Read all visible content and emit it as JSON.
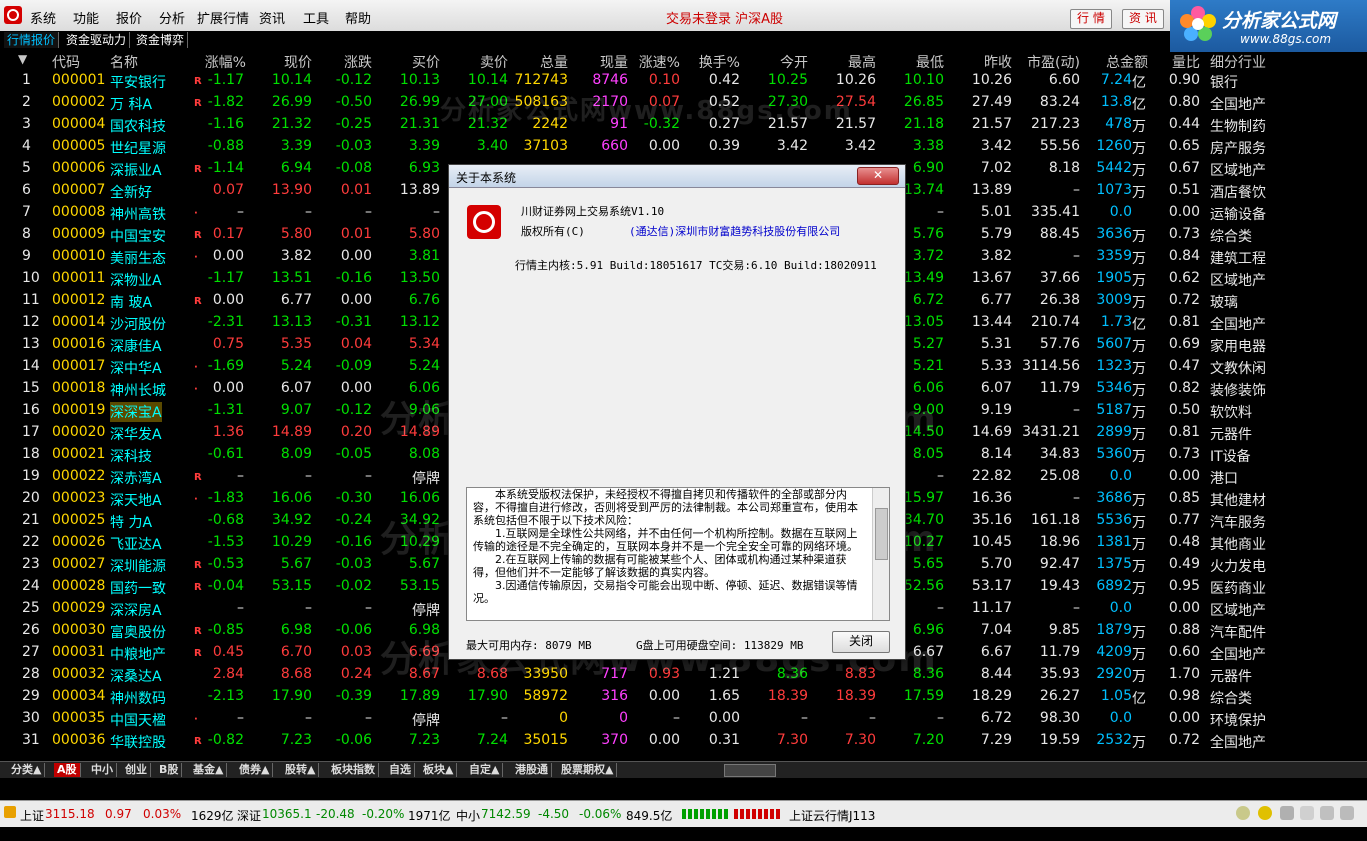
{
  "menubar": {
    "items": [
      "系统",
      "功能",
      "报价",
      "分析",
      "扩展行情",
      "资讯",
      "工具",
      "帮助"
    ],
    "status": "交易未登录  沪深A股",
    "buttons": [
      "行 情",
      "资 讯"
    ]
  },
  "brand": {
    "title": "分析家公式网",
    "url": "www.88gs.com"
  },
  "top_tabs": [
    "行情报价",
    "资金驱动力",
    "资金博弈"
  ],
  "table": {
    "headers": [
      "代码",
      "名称",
      "涨幅%",
      "现价",
      "涨跌",
      "买价",
      "卖价",
      "总量",
      "现量",
      "涨速%",
      "换手%",
      "今开",
      "最高",
      "最低",
      "昨收",
      "市盈(动)",
      "总金额",
      "量比",
      "细分行业"
    ],
    "rows": [
      {
        "i": "1",
        "code": "000001",
        "name": "平安银行",
        "b": "R",
        "chg": "-1.17",
        "price": "10.14",
        "diff": "-0.12",
        "buy": "10.13",
        "sell": "10.14",
        "vol": "712743",
        "cur": "8746",
        "spd": "0.10",
        "turn": "0.42",
        "open": "10.25",
        "high": "10.26",
        "low": "10.10",
        "prev": "10.26",
        "pe": "6.60",
        "amt": "7.24",
        "amtu": "亿",
        "lb": "0.90",
        "ind": "银行"
      },
      {
        "i": "2",
        "code": "000002",
        "name": "万 科A",
        "b": "R",
        "chg": "-1.82",
        "price": "26.99",
        "diff": "-0.50",
        "buy": "26.99",
        "sell": "27.00",
        "vol": "508163",
        "cur": "2170",
        "spd": "0.07",
        "turn": "0.52",
        "open": "27.30",
        "high": "27.54",
        "low": "26.85",
        "prev": "27.49",
        "pe": "83.24",
        "amt": "13.8",
        "amtu": "亿",
        "lb": "0.80",
        "ind": "全国地产"
      },
      {
        "i": "3",
        "code": "000004",
        "name": "国农科技",
        "b": "",
        "chg": "-1.16",
        "price": "21.32",
        "diff": "-0.25",
        "buy": "21.31",
        "sell": "21.32",
        "vol": "2242",
        "cur": "91",
        "spd": "-0.32",
        "turn": "0.27",
        "open": "21.57",
        "high": "21.57",
        "low": "21.18",
        "prev": "21.57",
        "pe": "217.23",
        "amt": "478",
        "amtu": "万",
        "lb": "0.44",
        "ind": "生物制药"
      },
      {
        "i": "4",
        "code": "000005",
        "name": "世纪星源",
        "b": "",
        "chg": "-0.88",
        "price": "3.39",
        "diff": "-0.03",
        "buy": "3.39",
        "sell": "3.40",
        "vol": "37103",
        "cur": "660",
        "spd": "0.00",
        "turn": "0.39",
        "open": "3.42",
        "high": "3.42",
        "low": "3.38",
        "prev": "3.42",
        "pe": "55.56",
        "amt": "1260",
        "amtu": "万",
        "lb": "0.65",
        "ind": "房产服务"
      },
      {
        "i": "5",
        "code": "000006",
        "name": "深振业A",
        "b": "R",
        "chg": "-1.14",
        "price": "6.94",
        "diff": "-0.08",
        "buy": "6.93",
        "sell": "",
        "vol": "",
        "cur": "",
        "spd": "",
        "turn": "",
        "open": "",
        "high": "",
        "low": "6.90",
        "prev": "7.02",
        "pe": "8.18",
        "amt": "5442",
        "amtu": "万",
        "lb": "0.67",
        "ind": "区域地产"
      },
      {
        "i": "6",
        "code": "000007",
        "name": "全新好",
        "b": "",
        "chg": "0.07",
        "price": "13.90",
        "diff": "0.01",
        "buy": "13.89",
        "sell": "",
        "vol": "",
        "cur": "",
        "spd": "",
        "turn": "",
        "open": "",
        "high": "",
        "low": "13.74",
        "prev": "13.89",
        "pe": "–",
        "amt": "1073",
        "amtu": "万",
        "lb": "0.51",
        "ind": "酒店餐饮"
      },
      {
        "i": "7",
        "code": "000008",
        "name": "神州高铁",
        "b": "·",
        "chg": "–",
        "price": "–",
        "diff": "–",
        "buy": "–",
        "sell": "",
        "vol": "",
        "cur": "",
        "spd": "",
        "turn": "",
        "open": "",
        "high": "",
        "low": "–",
        "prev": "5.01",
        "pe": "335.41",
        "amt": "0.0",
        "amtu": "",
        "lb": "0.00",
        "ind": "运输设备"
      },
      {
        "i": "8",
        "code": "000009",
        "name": "中国宝安",
        "b": "R",
        "chg": "0.17",
        "price": "5.80",
        "diff": "0.01",
        "buy": "5.80",
        "sell": "",
        "vol": "",
        "cur": "",
        "spd": "",
        "turn": "",
        "open": "",
        "high": "",
        "low": "5.76",
        "prev": "5.79",
        "pe": "88.45",
        "amt": "3636",
        "amtu": "万",
        "lb": "0.73",
        "ind": "综合类"
      },
      {
        "i": "9",
        "code": "000010",
        "name": "美丽生态",
        "b": "·",
        "chg": "0.00",
        "price": "3.82",
        "diff": "0.00",
        "buy": "3.81",
        "sell": "",
        "vol": "",
        "cur": "",
        "spd": "",
        "turn": "",
        "open": "",
        "high": "",
        "low": "3.72",
        "prev": "3.82",
        "pe": "–",
        "amt": "3359",
        "amtu": "万",
        "lb": "0.84",
        "ind": "建筑工程"
      },
      {
        "i": "10",
        "code": "000011",
        "name": "深物业A",
        "b": "",
        "chg": "-1.17",
        "price": "13.51",
        "diff": "-0.16",
        "buy": "13.50",
        "sell": "",
        "vol": "",
        "cur": "",
        "spd": "",
        "turn": "",
        "open": "",
        "high": "",
        "low": "13.49",
        "prev": "13.67",
        "pe": "37.66",
        "amt": "1905",
        "amtu": "万",
        "lb": "0.62",
        "ind": "区域地产"
      },
      {
        "i": "11",
        "code": "000012",
        "name": "南 玻A",
        "b": "R",
        "chg": "0.00",
        "price": "6.77",
        "diff": "0.00",
        "buy": "6.76",
        "sell": "",
        "vol": "",
        "cur": "",
        "spd": "",
        "turn": "",
        "open": "",
        "high": "",
        "low": "6.72",
        "prev": "6.77",
        "pe": "26.38",
        "amt": "3009",
        "amtu": "万",
        "lb": "0.72",
        "ind": "玻璃"
      },
      {
        "i": "12",
        "code": "000014",
        "name": "沙河股份",
        "b": "",
        "chg": "-2.31",
        "price": "13.13",
        "diff": "-0.31",
        "buy": "13.12",
        "sell": "",
        "vol": "",
        "cur": "",
        "spd": "",
        "turn": "",
        "open": "",
        "high": "",
        "low": "13.05",
        "prev": "13.44",
        "pe": "210.74",
        "amt": "1.73",
        "amtu": "亿",
        "lb": "0.81",
        "ind": "全国地产"
      },
      {
        "i": "13",
        "code": "000016",
        "name": "深康佳A",
        "b": "",
        "chg": "0.75",
        "price": "5.35",
        "diff": "0.04",
        "buy": "5.34",
        "sell": "",
        "vol": "",
        "cur": "",
        "spd": "",
        "turn": "",
        "open": "",
        "high": "",
        "low": "5.27",
        "prev": "5.31",
        "pe": "57.76",
        "amt": "5607",
        "amtu": "万",
        "lb": "0.69",
        "ind": "家用电器"
      },
      {
        "i": "14",
        "code": "000017",
        "name": "深中华A",
        "b": "·",
        "chg": "-1.69",
        "price": "5.24",
        "diff": "-0.09",
        "buy": "5.24",
        "sell": "",
        "vol": "",
        "cur": "",
        "spd": "",
        "turn": "",
        "open": "",
        "high": "",
        "low": "5.21",
        "prev": "5.33",
        "pe": "3114.56",
        "amt": "1323",
        "amtu": "万",
        "lb": "0.47",
        "ind": "文教休闲"
      },
      {
        "i": "15",
        "code": "000018",
        "name": "神州长城",
        "b": "·",
        "chg": "0.00",
        "price": "6.07",
        "diff": "0.00",
        "buy": "6.06",
        "sell": "",
        "vol": "",
        "cur": "",
        "spd": "",
        "turn": "",
        "open": "",
        "high": "",
        "low": "6.06",
        "prev": "6.07",
        "pe": "11.79",
        "amt": "5346",
        "amtu": "万",
        "lb": "0.82",
        "ind": "装修装饰"
      },
      {
        "i": "16",
        "code": "000019",
        "name": "深深宝A",
        "b": "",
        "chg": "-1.31",
        "price": "9.07",
        "diff": "-0.12",
        "buy": "9.06",
        "sell": "",
        "vol": "",
        "cur": "",
        "spd": "",
        "turn": "",
        "open": "",
        "high": "",
        "low": "9.00",
        "prev": "9.19",
        "pe": "–",
        "amt": "5187",
        "amtu": "万",
        "lb": "0.50",
        "ind": "软饮料"
      },
      {
        "i": "17",
        "code": "000020",
        "name": "深华发A",
        "b": "",
        "chg": "1.36",
        "price": "14.89",
        "diff": "0.20",
        "buy": "14.89",
        "sell": "",
        "vol": "",
        "cur": "",
        "spd": "",
        "turn": "",
        "open": "",
        "high": "",
        "low": "14.50",
        "prev": "14.69",
        "pe": "3431.21",
        "amt": "2899",
        "amtu": "万",
        "lb": "0.81",
        "ind": "元器件"
      },
      {
        "i": "18",
        "code": "000021",
        "name": "深科技",
        "b": "",
        "chg": "-0.61",
        "price": "8.09",
        "diff": "-0.05",
        "buy": "8.08",
        "sell": "",
        "vol": "",
        "cur": "",
        "spd": "",
        "turn": "",
        "open": "",
        "high": "",
        "low": "8.05",
        "prev": "8.14",
        "pe": "34.83",
        "amt": "5360",
        "amtu": "万",
        "lb": "0.73",
        "ind": "IT设备"
      },
      {
        "i": "19",
        "code": "000022",
        "name": "深赤湾A",
        "b": "R",
        "chg": "–",
        "price": "–",
        "diff": "–",
        "buy": "停牌",
        "sell": "",
        "vol": "",
        "cur": "",
        "spd": "",
        "turn": "",
        "open": "",
        "high": "",
        "low": "–",
        "prev": "22.82",
        "pe": "25.08",
        "amt": "0.0",
        "amtu": "",
        "lb": "0.00",
        "ind": "港口"
      },
      {
        "i": "20",
        "code": "000023",
        "name": "深天地A",
        "b": "·",
        "chg": "-1.83",
        "price": "16.06",
        "diff": "-0.30",
        "buy": "16.06",
        "sell": "",
        "vol": "",
        "cur": "",
        "spd": "",
        "turn": "",
        "open": "",
        "high": "",
        "low": "15.97",
        "prev": "16.36",
        "pe": "–",
        "amt": "3686",
        "amtu": "万",
        "lb": "0.85",
        "ind": "其他建材"
      },
      {
        "i": "21",
        "code": "000025",
        "name": "特 力A",
        "b": "",
        "chg": "-0.68",
        "price": "34.92",
        "diff": "-0.24",
        "buy": "34.92",
        "sell": "",
        "vol": "",
        "cur": "",
        "spd": "",
        "turn": "",
        "open": "",
        "high": "",
        "low": "34.70",
        "prev": "35.16",
        "pe": "161.18",
        "amt": "5536",
        "amtu": "万",
        "lb": "0.77",
        "ind": "汽车服务"
      },
      {
        "i": "22",
        "code": "000026",
        "name": "飞亚达A",
        "b": "",
        "chg": "-1.53",
        "price": "10.29",
        "diff": "-0.16",
        "buy": "10.29",
        "sell": "",
        "vol": "",
        "cur": "",
        "spd": "",
        "turn": "",
        "open": "",
        "high": "",
        "low": "10.27",
        "prev": "10.45",
        "pe": "18.96",
        "amt": "1381",
        "amtu": "万",
        "lb": "0.48",
        "ind": "其他商业"
      },
      {
        "i": "23",
        "code": "000027",
        "name": "深圳能源",
        "b": "R",
        "chg": "-0.53",
        "price": "5.67",
        "diff": "-0.03",
        "buy": "5.67",
        "sell": "",
        "vol": "",
        "cur": "",
        "spd": "",
        "turn": "",
        "open": "",
        "high": "",
        "low": "5.65",
        "prev": "5.70",
        "pe": "92.47",
        "amt": "1375",
        "amtu": "万",
        "lb": "0.49",
        "ind": "火力发电"
      },
      {
        "i": "24",
        "code": "000028",
        "name": "国药一致",
        "b": "R",
        "chg": "-0.04",
        "price": "53.15",
        "diff": "-0.02",
        "buy": "53.15",
        "sell": "",
        "vol": "",
        "cur": "",
        "spd": "",
        "turn": "",
        "open": "",
        "high": "",
        "low": "52.56",
        "prev": "53.17",
        "pe": "19.43",
        "amt": "6892",
        "amtu": "万",
        "lb": "0.95",
        "ind": "医药商业"
      },
      {
        "i": "25",
        "code": "000029",
        "name": "深深房A",
        "b": "",
        "chg": "–",
        "price": "–",
        "diff": "–",
        "buy": "停牌",
        "sell": "",
        "vol": "",
        "cur": "",
        "spd": "",
        "turn": "",
        "open": "",
        "high": "",
        "low": "–",
        "prev": "11.17",
        "pe": "–",
        "amt": "0.0",
        "amtu": "",
        "lb": "0.00",
        "ind": "区域地产"
      },
      {
        "i": "26",
        "code": "000030",
        "name": "富奥股份",
        "b": "R",
        "chg": "-0.85",
        "price": "6.98",
        "diff": "-0.06",
        "buy": "6.98",
        "sell": "",
        "vol": "",
        "cur": "",
        "spd": "",
        "turn": "",
        "open": "",
        "high": "",
        "low": "6.96",
        "prev": "7.04",
        "pe": "9.85",
        "amt": "1879",
        "amtu": "万",
        "lb": "0.88",
        "ind": "汽车配件"
      },
      {
        "i": "27",
        "code": "000031",
        "name": "中粮地产",
        "b": "R",
        "chg": "0.45",
        "price": "6.70",
        "diff": "0.03",
        "buy": "6.69",
        "sell": "",
        "vol": "",
        "cur": "",
        "spd": "",
        "turn": "",
        "open": "",
        "high": "",
        "low": "6.67",
        "prev": "6.67",
        "pe": "11.79",
        "amt": "4209",
        "amtu": "万",
        "lb": "0.60",
        "ind": "全国地产"
      },
      {
        "i": "28",
        "code": "000032",
        "name": "深桑达A",
        "b": "",
        "chg": "2.84",
        "price": "8.68",
        "diff": "0.24",
        "buy": "8.67",
        "sell": "8.68",
        "vol": "33950",
        "cur": "717",
        "spd": "0.93",
        "turn": "1.21",
        "open": "8.36",
        "high": "8.83",
        "low": "8.36",
        "prev": "8.44",
        "pe": "35.93",
        "amt": "2920",
        "amtu": "万",
        "lb": "1.70",
        "ind": "元器件"
      },
      {
        "i": "29",
        "code": "000034",
        "name": "神州数码",
        "b": "",
        "chg": "-2.13",
        "price": "17.90",
        "diff": "-0.39",
        "buy": "17.89",
        "sell": "17.90",
        "vol": "58972",
        "cur": "316",
        "spd": "0.00",
        "turn": "1.65",
        "open": "18.39",
        "high": "18.39",
        "low": "17.59",
        "prev": "18.29",
        "pe": "26.27",
        "amt": "1.05",
        "amtu": "亿",
        "lb": "0.98",
        "ind": "综合类"
      },
      {
        "i": "30",
        "code": "000035",
        "name": "中国天楹",
        "b": "·",
        "chg": "–",
        "price": "–",
        "diff": "–",
        "buy": "停牌",
        "sell": "–",
        "vol": "0",
        "cur": "0",
        "spd": "–",
        "turn": "0.00",
        "open": "–",
        "high": "–",
        "low": "–",
        "prev": "6.72",
        "pe": "98.30",
        "amt": "0.0",
        "amtu": "",
        "lb": "0.00",
        "ind": "环境保护"
      },
      {
        "i": "31",
        "code": "000036",
        "name": "华联控股",
        "b": "R",
        "chg": "-0.82",
        "price": "7.23",
        "diff": "-0.06",
        "buy": "7.23",
        "sell": "7.24",
        "vol": "35015",
        "cur": "370",
        "spd": "0.00",
        "turn": "0.31",
        "open": "7.30",
        "high": "7.30",
        "low": "7.20",
        "prev": "7.29",
        "pe": "19.59",
        "amt": "2532",
        "amtu": "万",
        "lb": "0.72",
        "ind": "全国地产"
      }
    ]
  },
  "watermark": "分析家公式网www.88gs.com",
  "bottom_tabs": [
    "分类▲",
    "A股",
    "中小",
    "创业",
    "B股",
    "基金▲",
    "债券▲",
    "股转▲",
    "板块指数",
    "自选",
    "板块▲",
    "自定▲",
    "港股通",
    "股票期权▲"
  ],
  "statusbar": {
    "sh_label": "上证",
    "sh_val": "3115.18",
    "sh_chg": "0.97",
    "sh_pct": "0.03%",
    "sh_amt": "1629亿",
    "sz_label": "深证",
    "sz_val": "10365.1",
    "sz_chg": "-20.48",
    "sz_pct": "-0.20%",
    "sz_amt": "1971亿",
    "zx_label": "中小",
    "zx_val": "7142.59",
    "zx_chg": "-4.50",
    "zx_pct": "-0.06%",
    "zx_amt": "849.5亿",
    "server": "上证云行情J113"
  },
  "dialog": {
    "title": "关于本系统",
    "close": "✕",
    "app_name": "川财证券网上交易系统V1.10",
    "copyright_label": "版权所有(C)",
    "company": "(通达信)深圳市财富趋势科技股份有限公司",
    "version": "行情主内核:5.91 Build:18051617 TC交易:6.10 Build:18020911",
    "notice": [
      "本系统受版权法保护，未经授权不得擅自拷贝和传播软件的全部或部分内容，不得擅自进行修改，否则将受到严厉的法律制裁。本公司郑重宣布，使用本系统包括但不限于以下技术风险：",
      "1.互联网是全球性公共网络，并不由任何一个机构所控制。数据在互联网上传输的途径是不完全确定的，互联网本身并不是一个完全安全可靠的网络环境。",
      "2.在互联网上传输的数据有可能被某些个人、团体或机构通过某种渠道获得，但他们并不一定能够了解该数据的真实内容。",
      "3.因通信传输原因，交易指令可能会出现中断、停顿、延迟、数据错误等情况。"
    ],
    "memory": "最大可用内存: 8079 MB",
    "disk": "G盘上可用硬盘空间: 113829 MB",
    "close_button": "关闭"
  }
}
